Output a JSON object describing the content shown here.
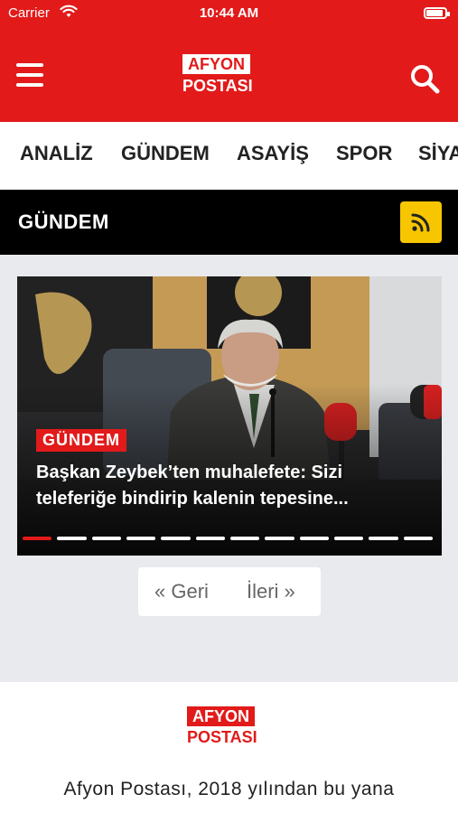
{
  "status_bar": {
    "carrier": "Carrier",
    "time": "10:44 AM",
    "battery_level": 0.9
  },
  "header": {
    "logo_top": "AFYON",
    "logo_bottom": "POSTASI"
  },
  "categories": [
    "ANALİZ",
    "GÜNDEM",
    "ASAYİŞ",
    "SPOR",
    "SİYA"
  ],
  "section": {
    "title": "GÜNDEM"
  },
  "slider": {
    "badge": "GÜNDEM",
    "title": "Başkan Zeybek’ten muhalefete: Sizi teleferiğe bindirip kalenin tepesine...",
    "dot_count": 12,
    "active_dot": 0
  },
  "pager": {
    "prev": "« Geri",
    "next": "İleri »"
  },
  "footer": {
    "logo_top": "AFYON",
    "logo_bottom": "POSTASI",
    "text": "Afyon Postası, 2018 yılından bu yana"
  },
  "colors": {
    "brand_red": "#e21a1a",
    "rss_yellow": "#f7c600",
    "section_black": "#000000"
  },
  "icons": {
    "menu": "hamburger-icon",
    "search": "search-icon",
    "rss": "rss-icon",
    "wifi": "wifi-icon",
    "battery": "battery-icon"
  }
}
